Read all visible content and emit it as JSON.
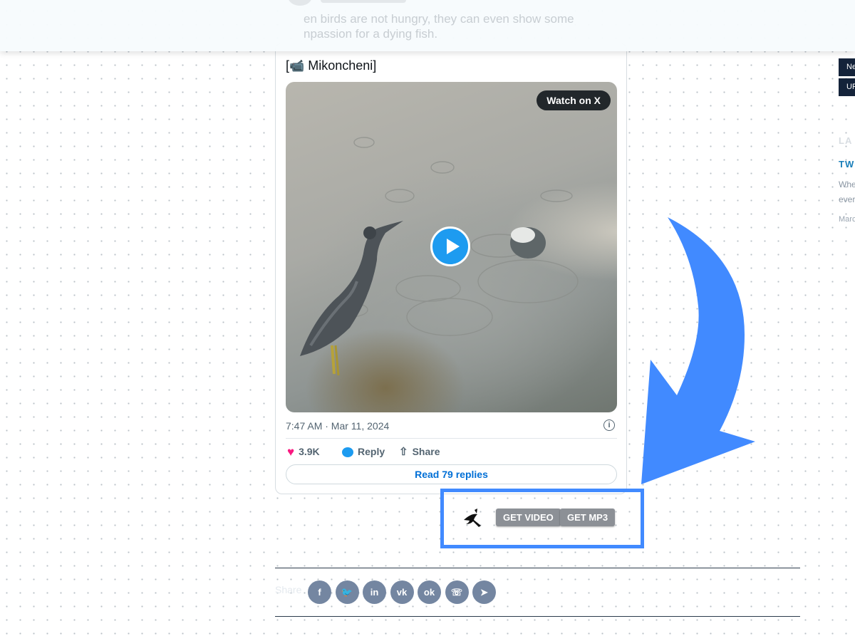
{
  "overlay": {
    "text_line1": "en birds are not hungry, they can even show some",
    "text_line2": "npassion for a dying fish."
  },
  "tweet": {
    "camera_emoji": "📹",
    "location": "Mikoncheni",
    "watch_label": "Watch on X",
    "timestamp": "7:47 AM · Mar 11, 2024",
    "likes": "3.9K",
    "reply_label": "Reply",
    "share_label": "Share",
    "read_replies": "Read 79 replies"
  },
  "downloader": {
    "get_video": "GET VIDEO",
    "get_mp3": "GET MP3"
  },
  "share": {
    "label": "Share",
    "icons": [
      "facebook-icon",
      "twitter-icon",
      "linkedin-icon",
      "vk-icon",
      "odnoklassniki-icon",
      "whatsapp-icon",
      "telegram-icon"
    ],
    "glyphs": [
      "f",
      "🐦",
      "in",
      "vk",
      "ok",
      "☏",
      "➤"
    ]
  },
  "sidebar": {
    "tag1": "Ne",
    "tag2": "UP",
    "section_title": "LA",
    "article_title": "TW",
    "excerpt1": "Whe",
    "excerpt2": "ever",
    "date": "Marc"
  },
  "colors": {
    "accent_blue": "#418aff",
    "twitter_blue": "#1d9bf0",
    "like_pink": "#f91880",
    "share_icon_bg": "#7486a1",
    "button_gray": "#8c9096"
  }
}
